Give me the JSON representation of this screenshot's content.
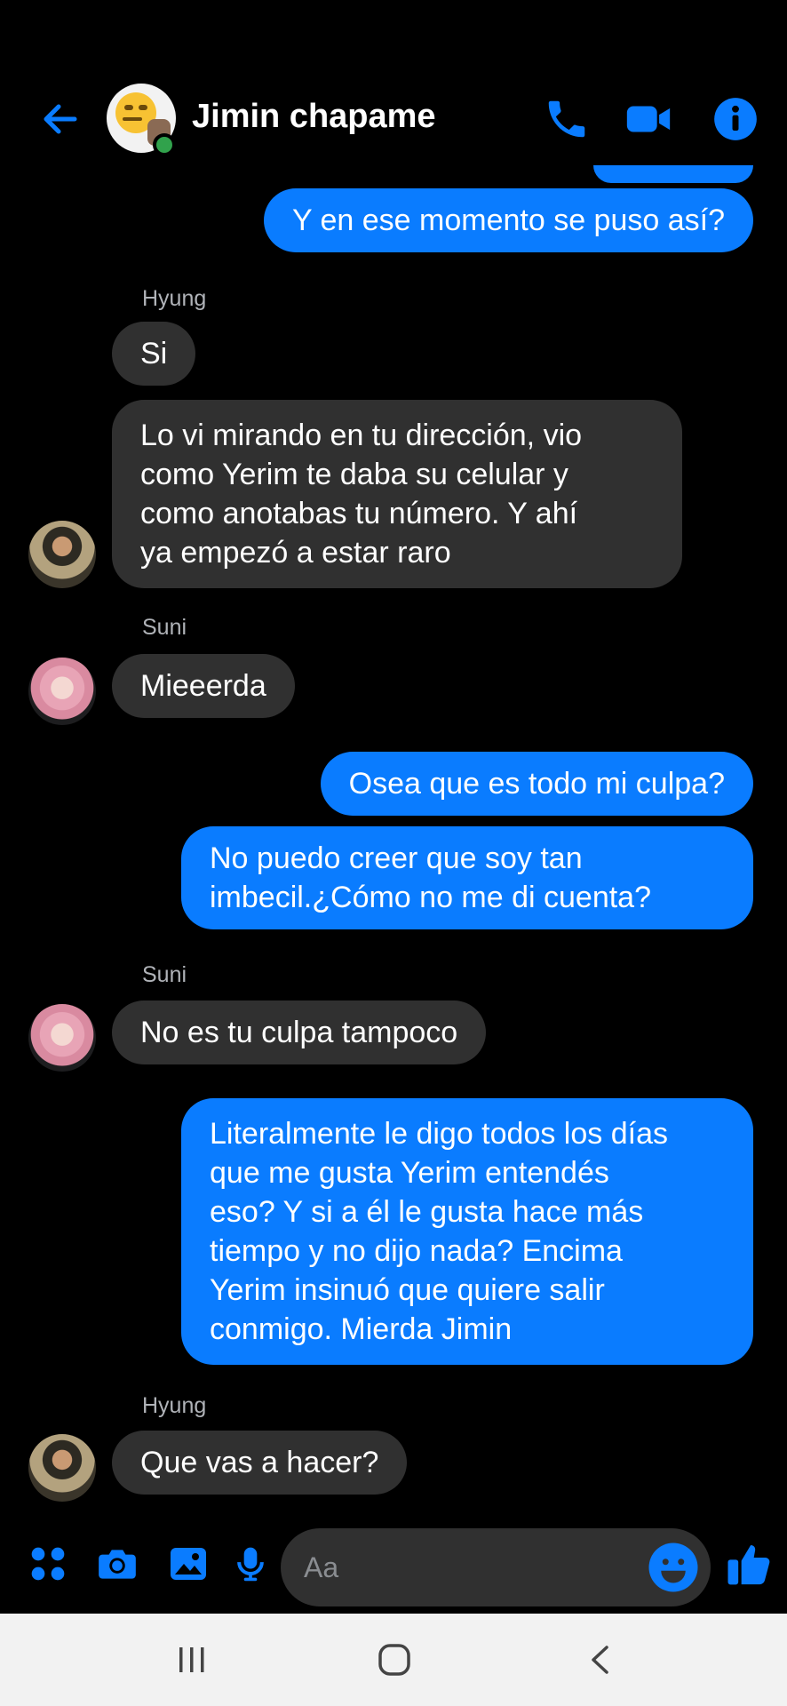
{
  "header": {
    "contact_name": "Jimin chapame",
    "icons": [
      "back-arrow-icon",
      "phone-icon",
      "video-camera-icon",
      "info-icon"
    ],
    "accent_color": "#0a7cff",
    "online_color": "#31a24c"
  },
  "messages": [
    {
      "type": "sent",
      "text": "Y en ese momento se puso así?"
    },
    {
      "type": "label",
      "text": "Hyung"
    },
    {
      "type": "received",
      "sender": "Hyung",
      "text": "Si"
    },
    {
      "type": "received",
      "sender": "Hyung",
      "text": "Lo vi mirando en tu dirección, vio como Yerim te daba su celular y como anotabas tu número. Y ahí ya empezó a estar raro"
    },
    {
      "type": "label",
      "text": "Suni"
    },
    {
      "type": "received",
      "sender": "Suni",
      "text": "Mieeerda"
    },
    {
      "type": "sent",
      "text": "Osea que es todo mi culpa?"
    },
    {
      "type": "sent",
      "text": "No puedo creer que soy tan imbecil.¿Cómo no me di cuenta?"
    },
    {
      "type": "label",
      "text": "Suni"
    },
    {
      "type": "received",
      "sender": "Suni",
      "text": "No es tu culpa tampoco"
    },
    {
      "type": "sent",
      "text": "Literalmente le digo todos los días que me gusta Yerim entendés eso?  Y si a él le gusta hace más tiempo y no dijo nada? Encima Yerim insinuó que quiere salir conmigo. Mierda Jimin"
    },
    {
      "type": "label",
      "text": "Hyung"
    },
    {
      "type": "received",
      "sender": "Hyung",
      "text": "Que vas a hacer?"
    }
  ],
  "bubbles": {
    "m1": "Y en ese momento se puso así?",
    "label_hyung_1": "Hyung",
    "m2": "Si",
    "m3": "Lo vi mirando en tu dirección, vio\ncomo Yerim te daba su celular y\ncomo anotabas tu número. Y ahí\nya empezó a estar raro",
    "label_suni_1": "Suni",
    "m4": "Mieeerda",
    "m5": "Osea que es todo mi culpa?",
    "m6": "No puedo creer que soy tan\nimbecil.¿Cómo no me di cuenta?",
    "label_suni_2": "Suni",
    "m7": "No es tu culpa tampoco",
    "m8": "Literalmente le digo todos los días\nque me gusta Yerim entendés\neso?  Y si a él le gusta hace más\ntiempo y no dijo nada? Encima\nYerim insinuó que quiere salir\nconmigo. Mierda Jimin",
    "label_hyung_2": "Hyung",
    "m9": "Que vas a hacer?"
  },
  "composer": {
    "placeholder": "Aa",
    "icons": [
      "apps-grid-icon",
      "camera-icon",
      "gallery-icon",
      "microphone-icon",
      "emoji-icon",
      "thumbs-up-icon"
    ]
  },
  "navbar": {
    "icons": [
      "recent-apps-icon",
      "home-icon",
      "back-icon"
    ]
  },
  "colors": {
    "sent_bubble": "#0a7cff",
    "received_bubble": "#303030",
    "background": "#000000"
  }
}
